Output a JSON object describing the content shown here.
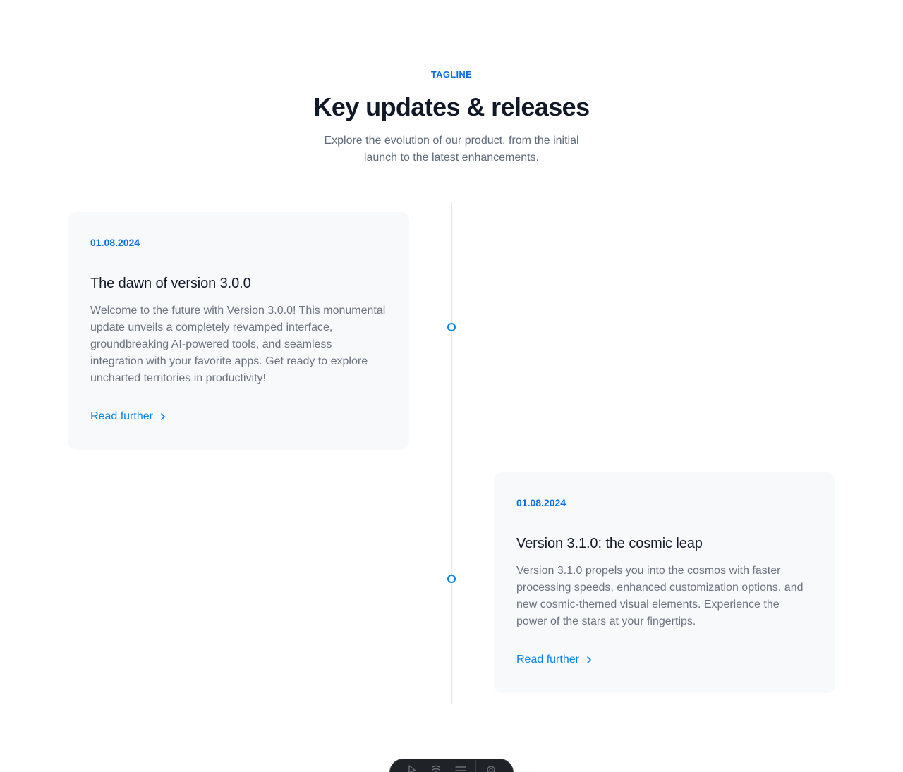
{
  "header": {
    "tagline": "TAGLINE",
    "title": "Key updates & releases",
    "subtitle": "Explore the evolution of our product, from the initial launch to the latest enhancements."
  },
  "timeline": {
    "entries": [
      {
        "date": "01.08.2024",
        "title": "The dawn of version 3.0.0",
        "body": "Welcome to the future with Version 3.0.0! This monumental update unveils a completely revamped interface, groundbreaking AI-powered tools, and seamless integration with your favorite apps. Get ready to explore uncharted territories in productivity!",
        "link_label": "Read further",
        "link_icon": "chevron-right-icon"
      },
      {
        "date": "01.08.2024",
        "title": "Version 3.1.0: the cosmic leap",
        "body": "Version 3.1.0 propels you into the cosmos with faster processing speeds, enhanced customization options, and new cosmic-themed visual elements. Experience the power of the stars at your fingertips.",
        "link_label": "Read further",
        "link_icon": "chevron-right-icon"
      }
    ]
  },
  "dock": {
    "icons": [
      "pointer-icon",
      "comment-icon",
      "menu-icon",
      "settings-icon"
    ]
  },
  "colors": {
    "accent": "#0a6fe8",
    "link": "#0a84f0",
    "card_background": "#f8f9fb",
    "heading": "#111827",
    "muted_text": "#6b7280",
    "timeline_line": "#e3e6eb"
  }
}
